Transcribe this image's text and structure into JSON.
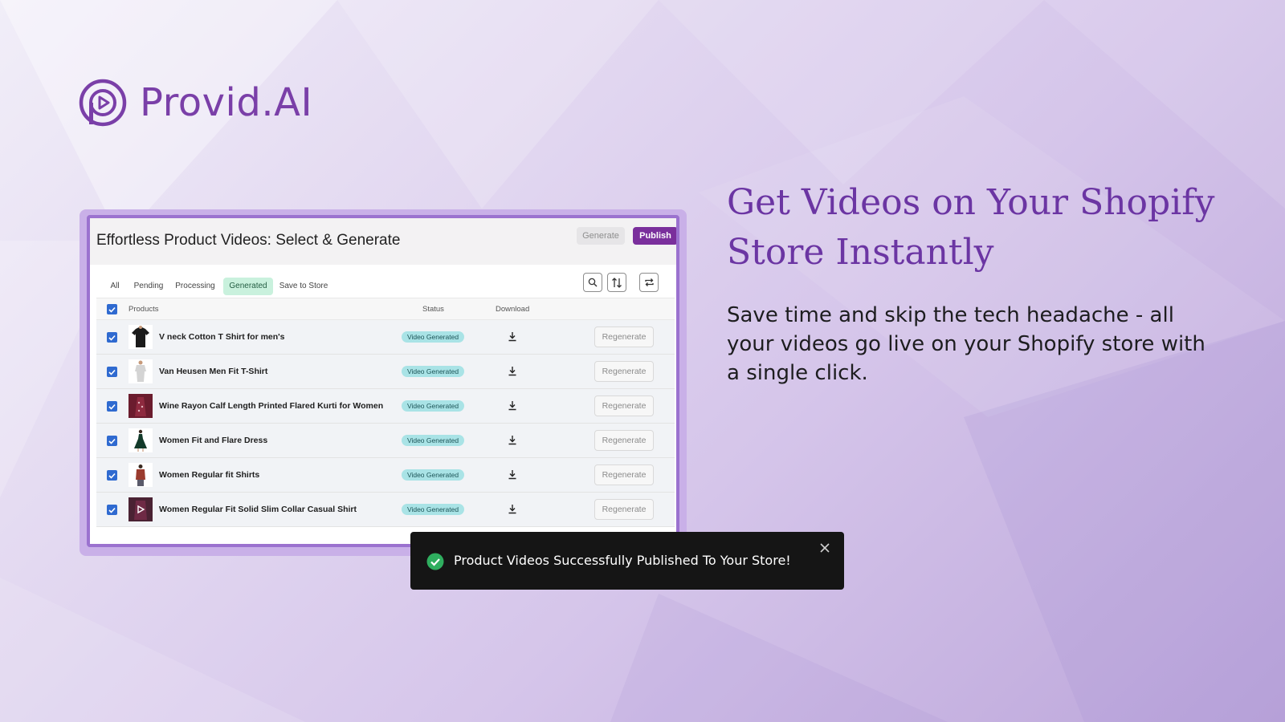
{
  "brand": {
    "name": "Provid.AI",
    "accent": "#7a3fa8"
  },
  "hero": {
    "headline": "Get Videos on Your Shopify Store Instantly",
    "body": "Save time and skip the tech headache - all your videos go live on your Shopify store with a single click."
  },
  "app": {
    "title": "Effortless Product Videos: Select &  Generate",
    "generate_label": "Generate",
    "publish_label": "Publish",
    "tabs": [
      {
        "label": "All",
        "active": false
      },
      {
        "label": "Pending",
        "active": false
      },
      {
        "label": "Processing",
        "active": false
      },
      {
        "label": "Generated",
        "active": true
      },
      {
        "label": "Save to Store",
        "active": false
      }
    ],
    "toolbar_icons": [
      "search-icon",
      "sort-icon",
      "refresh-icon"
    ],
    "columns": {
      "products": "Products",
      "status": "Status",
      "download": "Download"
    },
    "rows": [
      {
        "name": "V neck Cotton T Shirt for men's",
        "status": "Video Generated",
        "action": "Regenerate",
        "checked": true
      },
      {
        "name": "Van Heusen Men Fit T-Shirt",
        "status": "Video Generated",
        "action": "Regenerate",
        "checked": true
      },
      {
        "name": "Wine Rayon Calf Length Printed Flared Kurti for Women",
        "status": "Video Generated",
        "action": "Regenerate",
        "checked": true
      },
      {
        "name": "Women Fit and Flare Dress",
        "status": "Video Generated",
        "action": "Regenerate",
        "checked": true
      },
      {
        "name": "Women Regular fit Shirts",
        "status": "Video Generated",
        "action": "Regenerate",
        "checked": true
      },
      {
        "name": "Women Regular Fit Solid Slim Collar Casual Shirt",
        "status": "Video Generated",
        "action": "Regenerate",
        "checked": true
      }
    ]
  },
  "toast": {
    "message": "Product Videos Successfully Published To Your Store!",
    "icon": "check-circle-icon",
    "close_icon": "close-icon"
  }
}
